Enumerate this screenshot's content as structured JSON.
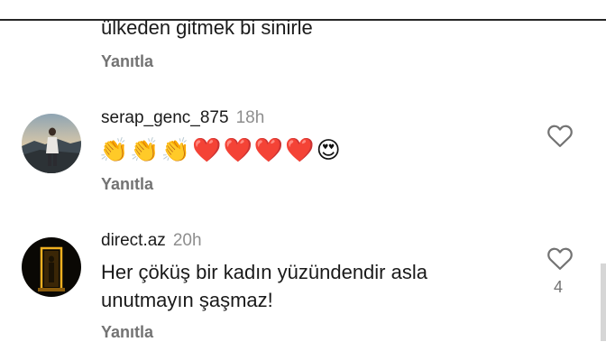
{
  "top_comment": {
    "text": "ülkeden gitmek bi sinirle",
    "reply_label": "Yanıtla"
  },
  "comments": [
    {
      "username": "serap_genc_875",
      "time": "18h",
      "emojis": [
        "👏",
        "👏",
        "👏",
        "❤️",
        "❤️",
        "❤️",
        "❤️",
        "😍"
      ],
      "reply_label": "Yanıtla"
    },
    {
      "username": "direct.az",
      "time": "20h",
      "text_line1": "Her çöküş bir kadın yüzündendir asla",
      "text_line2": "unutmayın şaşmaz!",
      "likes": "4",
      "reply_label": "Yanıtla"
    }
  ],
  "colors": {
    "text": "#1a1a1a",
    "muted": "#737373",
    "time": "#8e8e8e"
  },
  "icons": {
    "like": "heart-outline-icon"
  }
}
